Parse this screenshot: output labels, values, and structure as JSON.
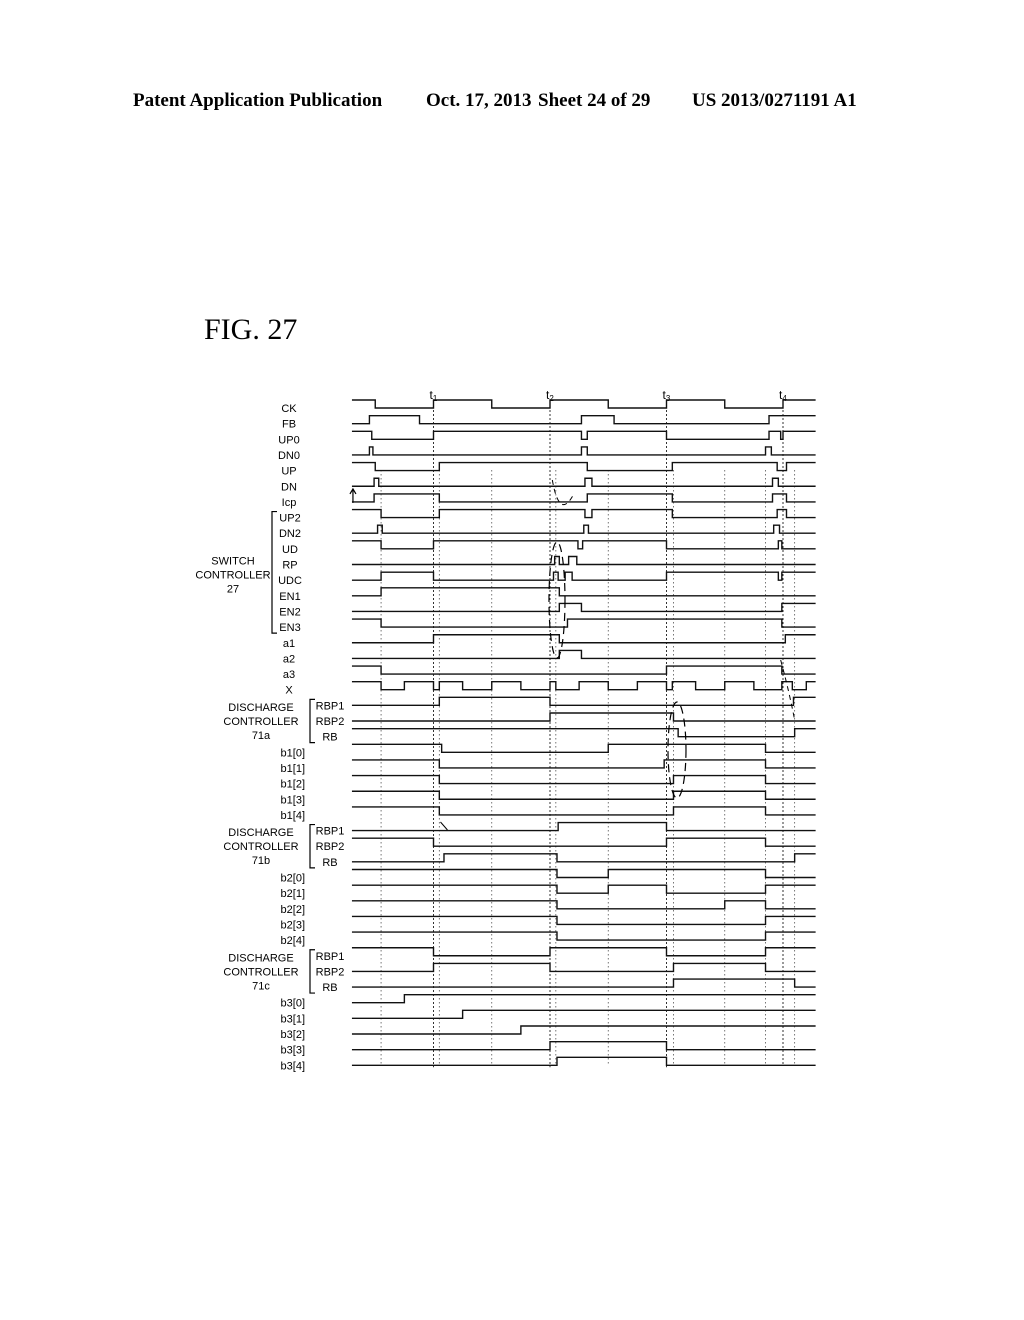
{
  "header": {
    "publication": "Patent Application Publication",
    "date": "Oct. 17, 2013",
    "sheet": "Sheet 24 of 29",
    "number": "US 2013/0271191 A1"
  },
  "figure": {
    "title": "FIG. 27",
    "time_markers": [
      {
        "label": "t1",
        "t": 1
      },
      {
        "label": "t2",
        "t": 2
      },
      {
        "label": "t3",
        "t": 3
      },
      {
        "label": "t4",
        "t": 4
      }
    ],
    "time_range": [
      0.3,
      4.28
    ],
    "groups": [
      {
        "lines": [
          "SWITCH",
          "CONTROLLER",
          "27"
        ],
        "first": "UP2",
        "last": "EN3"
      },
      {
        "lines": [
          "DISCHARGE",
          "CONTROLLER",
          "71a"
        ],
        "first": "RBP1",
        "last": "RB",
        "index": 0
      },
      {
        "lines": [
          "DISCHARGE",
          "CONTROLLER",
          "71b"
        ],
        "first": "RBP1",
        "last": "RB",
        "index": 1
      },
      {
        "lines": [
          "DISCHARGE",
          "CONTROLLER",
          "71c"
        ],
        "first": "RBP1",
        "last": "RB",
        "index": 2
      }
    ],
    "signals": [
      {
        "name": "CK",
        "init": 1,
        "edges": [
          0.5,
          1.0,
          1.5,
          2.0,
          2.5,
          3.0,
          3.5,
          4.0
        ]
      },
      {
        "name": "FB",
        "init": 0,
        "edges": [
          0.45,
          0.88,
          2.27,
          2.55,
          3.88
        ]
      },
      {
        "name": "UP0",
        "init": 1,
        "edges": [
          0.47,
          1.0,
          2.27,
          2.32,
          3.0,
          3.88,
          3.98,
          4.0
        ]
      },
      {
        "name": "DN0",
        "init": 0,
        "edges": [
          0.45,
          0.48,
          2.27,
          2.32,
          3.85,
          3.9
        ]
      },
      {
        "name": "UP",
        "init": 1,
        "edges": [
          0.5,
          1.05,
          2.32,
          3.05,
          3.95,
          4.03
        ]
      },
      {
        "name": "DN",
        "init": 0,
        "edges": [
          0.49,
          0.53,
          2.3,
          2.36,
          3.91,
          3.96
        ]
      },
      {
        "name": "Icp",
        "init": 0,
        "edges": [
          0.49,
          1.05,
          2.32,
          3.05,
          3.91,
          4.03
        ],
        "style": "icp"
      },
      {
        "name": "UP2",
        "init": 1,
        "edges": [
          0.55,
          1.05,
          2.3,
          2.36,
          3.05,
          3.95,
          4.03
        ]
      },
      {
        "name": "DN2",
        "init": 0,
        "edges": [
          0.52,
          0.56,
          2.29,
          2.33,
          3.92,
          3.97
        ]
      },
      {
        "name": "UD",
        "init": 1,
        "edges": [
          0.55,
          1.0,
          2.24,
          2.28,
          3.0,
          3.96,
          3.99
        ]
      },
      {
        "name": "RP",
        "init": 0,
        "edges": [
          2.04,
          2.08,
          2.16,
          2.23
        ]
      },
      {
        "name": "UDC",
        "init": 0,
        "edges": [
          0.55,
          1.0,
          2.03,
          2.07,
          2.13,
          2.19,
          3.0,
          3.96,
          3.99
        ]
      },
      {
        "name": "EN1",
        "init": 0,
        "edges": [
          0.55,
          2.08
        ]
      },
      {
        "name": "EN2",
        "init": 0,
        "edges": [
          2.08,
          2.27,
          3.99
        ]
      },
      {
        "name": "EN3",
        "init": 1,
        "edges": [
          0.55,
          2.15,
          3.99
        ]
      },
      {
        "name": "a1",
        "init": 0,
        "edges": [
          1.0,
          2.08,
          4.02
        ]
      },
      {
        "name": "a2",
        "init": 0,
        "edges": [
          2.08,
          2.27
        ]
      },
      {
        "name": "a3",
        "init": 1,
        "edges": [
          0.55,
          3.0,
          3.99
        ]
      },
      {
        "name": "X",
        "init": 1,
        "edges": [
          0.55,
          0.75,
          1.0,
          1.05,
          1.25,
          1.5,
          1.75,
          2.0,
          2.05,
          2.25,
          2.5,
          2.75,
          3.0,
          3.05,
          3.25,
          3.5,
          3.75,
          3.99,
          4.08,
          4.2
        ]
      },
      {
        "name": "RBP1",
        "init": 0,
        "edges": [
          1.05,
          2.0,
          4.09
        ],
        "group": 1
      },
      {
        "name": "RBP2",
        "init": 0,
        "edges": [
          2.0,
          3.06
        ],
        "group": 1
      },
      {
        "name": "RB",
        "init": 1,
        "edges": [
          3.1,
          4.1
        ],
        "group": 1
      },
      {
        "name": "b1[0]",
        "init": 1,
        "edges": [
          1.07,
          2.5,
          3.85
        ]
      },
      {
        "name": "b1[1]",
        "init": 1,
        "edges": [
          1.05,
          2.98,
          3.85
        ]
      },
      {
        "name": "b1[2]",
        "init": 1,
        "edges": [
          1.05,
          3.06,
          3.85
        ]
      },
      {
        "name": "b1[3]",
        "init": 1,
        "edges": [
          1.05,
          3.06,
          3.85
        ]
      },
      {
        "name": "b1[4]",
        "init": 1,
        "edges": [
          1.05,
          3.06,
          3.85
        ]
      },
      {
        "name": "RBP1",
        "init": 0,
        "edges": [
          2.07,
          3.0
        ],
        "group": 2
      },
      {
        "name": "RBP2",
        "init": 1,
        "edges": [
          1.0,
          3.0,
          3.85
        ],
        "group": 2
      },
      {
        "name": "RB",
        "init": 0,
        "edges": [
          1.09,
          2.06,
          4.1
        ],
        "group": 2
      },
      {
        "name": "b2[0]",
        "init": 1,
        "edges": [
          2.06,
          2.5,
          3.85
        ]
      },
      {
        "name": "b2[1]",
        "init": 1,
        "edges": [
          2.06,
          2.5,
          3.0,
          3.85
        ]
      },
      {
        "name": "b2[2]",
        "init": 1,
        "edges": [
          2.06,
          3.5,
          3.85
        ]
      },
      {
        "name": "b2[3]",
        "init": 1,
        "edges": [
          2.06,
          3.85
        ]
      },
      {
        "name": "b2[4]",
        "init": 1,
        "edges": [
          2.06,
          3.85
        ]
      },
      {
        "name": "RBP1",
        "init": 1,
        "edges": [
          1.0,
          2.0,
          3.0,
          3.85
        ],
        "group": 3
      },
      {
        "name": "RBP2",
        "init": 0,
        "edges": [
          1.0,
          2.0,
          3.06,
          3.85
        ],
        "group": 3
      },
      {
        "name": "RB",
        "init": 0,
        "edges": [
          3.06,
          4.1
        ],
        "group": 3
      },
      {
        "name": "b3[0]",
        "init": 0,
        "edges": [
          0.75
        ]
      },
      {
        "name": "b3[1]",
        "init": 0,
        "edges": [
          1.25
        ]
      },
      {
        "name": "b3[2]",
        "init": 0,
        "edges": [
          1.75
        ]
      },
      {
        "name": "b3[3]",
        "init": 0,
        "edges": [
          2.0,
          3.0
        ]
      },
      {
        "name": "b3[4]",
        "init": 0,
        "edges": [
          2.06,
          3.0
        ]
      }
    ]
  }
}
